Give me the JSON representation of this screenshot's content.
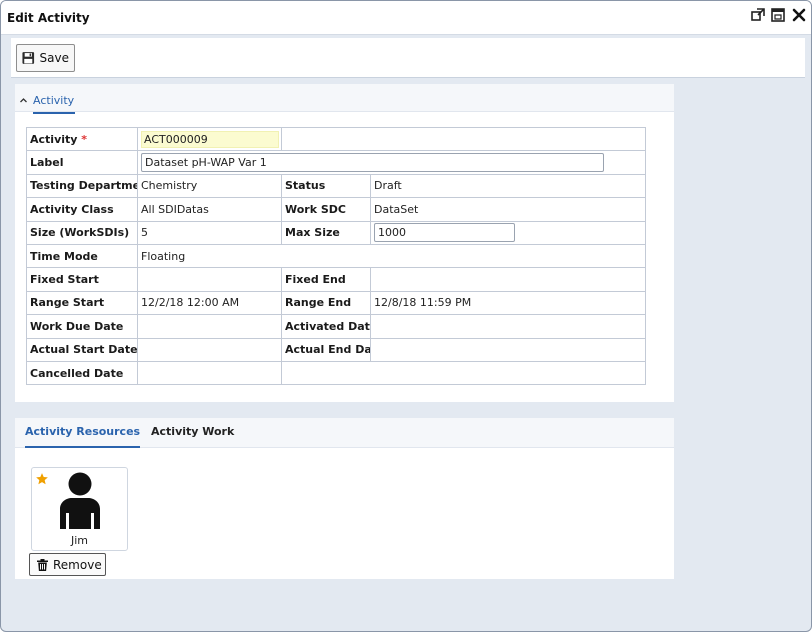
{
  "window": {
    "title": "Edit Activity",
    "icons": [
      "popout-icon",
      "maximize-icon",
      "close-icon"
    ]
  },
  "toolbar": {
    "save_label": "Save"
  },
  "activity_panel": {
    "section_label": "Activity",
    "fields": {
      "activity": {
        "label": "Activity",
        "required_mark": "*",
        "value": "ACT000009"
      },
      "label": {
        "label": "Label",
        "value": "Dataset pH-WAP Var 1"
      },
      "testing_department": {
        "label": "Testing Department",
        "value": "Chemistry"
      },
      "status": {
        "label": "Status",
        "value": "Draft"
      },
      "activity_class": {
        "label": "Activity Class",
        "value": "All SDIDatas"
      },
      "work_sdc": {
        "label": "Work SDC",
        "value": "DataSet"
      },
      "size": {
        "label": "Size (WorkSDIs)",
        "value": "5"
      },
      "max_size": {
        "label": "Max Size",
        "value": "1000"
      },
      "time_mode": {
        "label": "Time Mode",
        "value": "Floating"
      },
      "fixed_start": {
        "label": "Fixed Start",
        "value": ""
      },
      "fixed_end": {
        "label": "Fixed End",
        "value": ""
      },
      "range_start": {
        "label": "Range Start",
        "value": "12/2/18 12:00 AM"
      },
      "range_end": {
        "label": "Range End",
        "value": "12/8/18 11:59 PM"
      },
      "work_due_date": {
        "label": "Work Due Date",
        "value": ""
      },
      "activated_date": {
        "label": "Activated Date",
        "value": ""
      },
      "actual_start_date": {
        "label": "Actual Start Date",
        "value": ""
      },
      "actual_end_date": {
        "label": "Actual End Date",
        "value": ""
      },
      "cancelled_date": {
        "label": "Cancelled Date",
        "value": ""
      }
    }
  },
  "resources_panel": {
    "tabs": [
      {
        "label": "Activity Resources",
        "active": true
      },
      {
        "label": "Activity Work",
        "active": false
      }
    ],
    "resource": {
      "name": "Jim",
      "starred": true
    },
    "remove_label": "Remove"
  },
  "colors": {
    "accent": "#2a63ad",
    "star": "#f0a000",
    "key_field_bg": "#fbfbd0",
    "required": "#d33333",
    "background": "#e3e9f1"
  }
}
